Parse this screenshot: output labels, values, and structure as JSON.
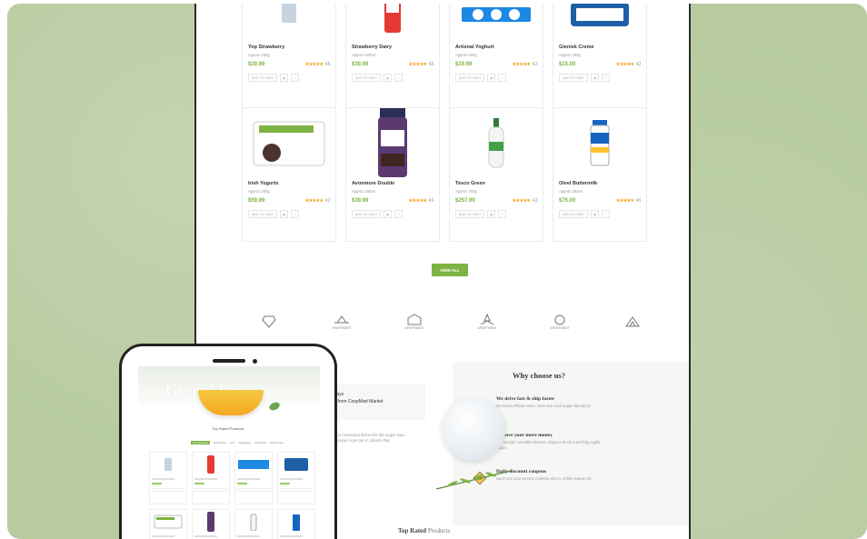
{
  "colors": {
    "accent": "#7cb342",
    "background": "#b7cb9f",
    "stars": "#f5a623"
  },
  "products_row1": [
    {
      "name": "Yop Strawberry",
      "size": "Approx 160g",
      "price": "$29.99",
      "rating": "4.6"
    },
    {
      "name": "Strawberry Dairy",
      "size": "Approx 500ml",
      "price": "$39.99",
      "rating": "4.5"
    },
    {
      "name": "Artisnal Yoghurt",
      "size": "Approx 500g",
      "price": "$19.99",
      "rating": "4.3"
    },
    {
      "name": "Glenisk Creme",
      "size": "Approx 250g",
      "price": "$15.00",
      "rating": "4.2"
    }
  ],
  "products_row2": [
    {
      "name": "Irish Yogurts",
      "size": "Approx 200g",
      "price": "$59.99",
      "rating": "4.2"
    },
    {
      "name": "Avonmore Double",
      "size": "Approx 250ml",
      "price": "$39.99",
      "rating": "4.6"
    },
    {
      "name": "Tesco Green",
      "size": "Approx 700g",
      "price": "$257.99",
      "rating": "4.3"
    },
    {
      "name": "Olvel Buttermilk",
      "size": "Approx 284ml",
      "price": "$75.00",
      "rating": "4.5"
    }
  ],
  "product_card": {
    "stars": "★★★★★",
    "add_to_cart": "ADD TO CART"
  },
  "view_all_label": "VIEW ALL",
  "brand_logos": [
    "APARTMENT",
    "APARTMENT",
    "APARTMENT",
    "APARTMENT"
  ],
  "why_choose": {
    "title": "Why choose us?",
    "features": [
      {
        "title": "We drive fast & ship faster",
        "desc": "Ut viverra efficitur enim, vitae suis mod augue blandit elt"
      },
      {
        "title": "We save your more money",
        "desc": "Sed semper convallis ultricies. Aliqua erat elit eunt finlay ngilla augue."
      },
      {
        "title": "Daily discount coupons",
        "desc": "Nunc non uma viverra, molestie elis in, pellen tesque elit."
      }
    ]
  },
  "newsletter": {
    "line1": "ry days",
    "line2": "ries from CoopMart Market",
    "body": "tanc, vi consequat dictus nisi tilla augue lique, ullamcorper eget dui ut, lobortis lhar."
  },
  "top_rated": {
    "bold": "Top Rated",
    "rest": "Products"
  },
  "phone": {
    "hero": "GreenMart",
    "section": "Top Rated Products",
    "tabs": [
      "All Categories",
      "Everything",
      "Fruit",
      "Vegetables",
      "Fresh Milk",
      "Drinks Juice"
    ]
  }
}
